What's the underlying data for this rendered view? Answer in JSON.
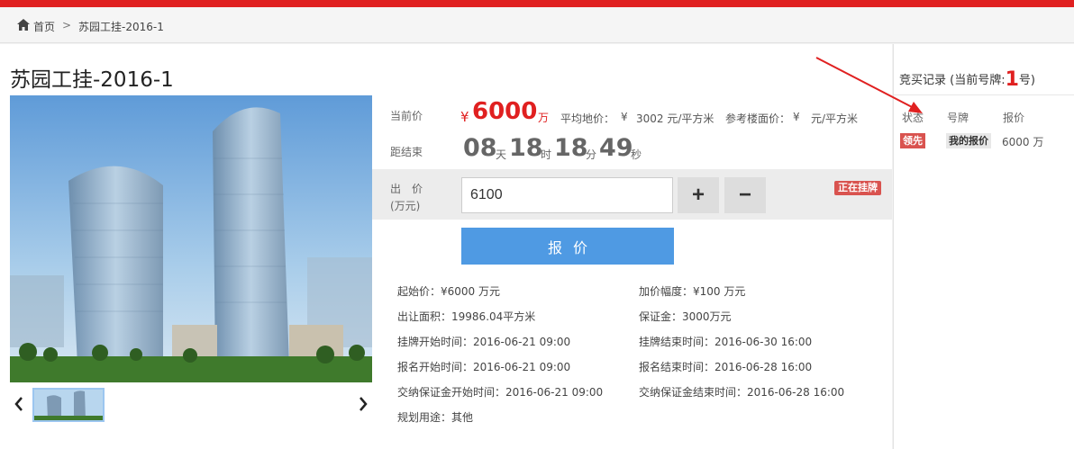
{
  "breadcrumb": {
    "home": "首页",
    "separator": ">",
    "current": "苏园工挂-2016-1"
  },
  "title": "苏园工挂-2016-1",
  "price": {
    "label": "当前价",
    "symbol": "¥",
    "value": "6000",
    "unit": "万",
    "avg_land_label": "平均地价：",
    "avg_land_symbol": "¥",
    "avg_land_value": "3002 元/平方米",
    "floor_label": "参考楼面价：",
    "floor_symbol": "¥",
    "floor_value": "元/平方米"
  },
  "countdown": {
    "label": "距结束",
    "days": "08",
    "days_unit": "天",
    "hours": "18",
    "hours_unit": "时",
    "minutes": "18",
    "minutes_unit": "分",
    "seconds": "49",
    "seconds_unit": "秒"
  },
  "bid": {
    "label_line1": "出　价",
    "label_line2": "(万元)",
    "value": "6100",
    "plus": "+",
    "minus": "−",
    "status": "正在挂牌",
    "submit": "报价"
  },
  "details": [
    {
      "label": "起始价：",
      "value": "¥6000  万元"
    },
    {
      "label": "加价幅度：",
      "value": "¥100  万元"
    },
    {
      "label": "出让面积：",
      "value": "19986.04平方米"
    },
    {
      "label": "保证金：",
      "value": "3000万元"
    },
    {
      "label": "挂牌开始时间：",
      "value": "2016-06-21 09:00"
    },
    {
      "label": "挂牌结束时间：",
      "value": "2016-06-30 16:00"
    },
    {
      "label": "报名开始时间：",
      "value": "2016-06-21 09:00"
    },
    {
      "label": "报名结束时间：",
      "value": "2016-06-28 16:00"
    },
    {
      "label": "交纳保证金开始时间：",
      "value": "2016-06-21 09:00"
    },
    {
      "label": "交纳保证金结束时间：",
      "value": "2016-06-28 16:00"
    },
    {
      "label": "规划用途：",
      "value": "其他"
    }
  ],
  "records": {
    "title": "竞买记录 (当前号牌:",
    "number": "1",
    "suffix": "号)",
    "col_status": "状态",
    "col_plate": "号牌",
    "col_price": "报价",
    "row": {
      "status": "领先",
      "plate": "我的报价",
      "price": "6000 万"
    }
  },
  "colors": {
    "accent": "#e02020",
    "button": "#4f9ae3",
    "badge": "#d9534f"
  },
  "icons": {
    "home": "home-icon",
    "prev": "chevron-left-icon",
    "next": "chevron-right-icon"
  }
}
